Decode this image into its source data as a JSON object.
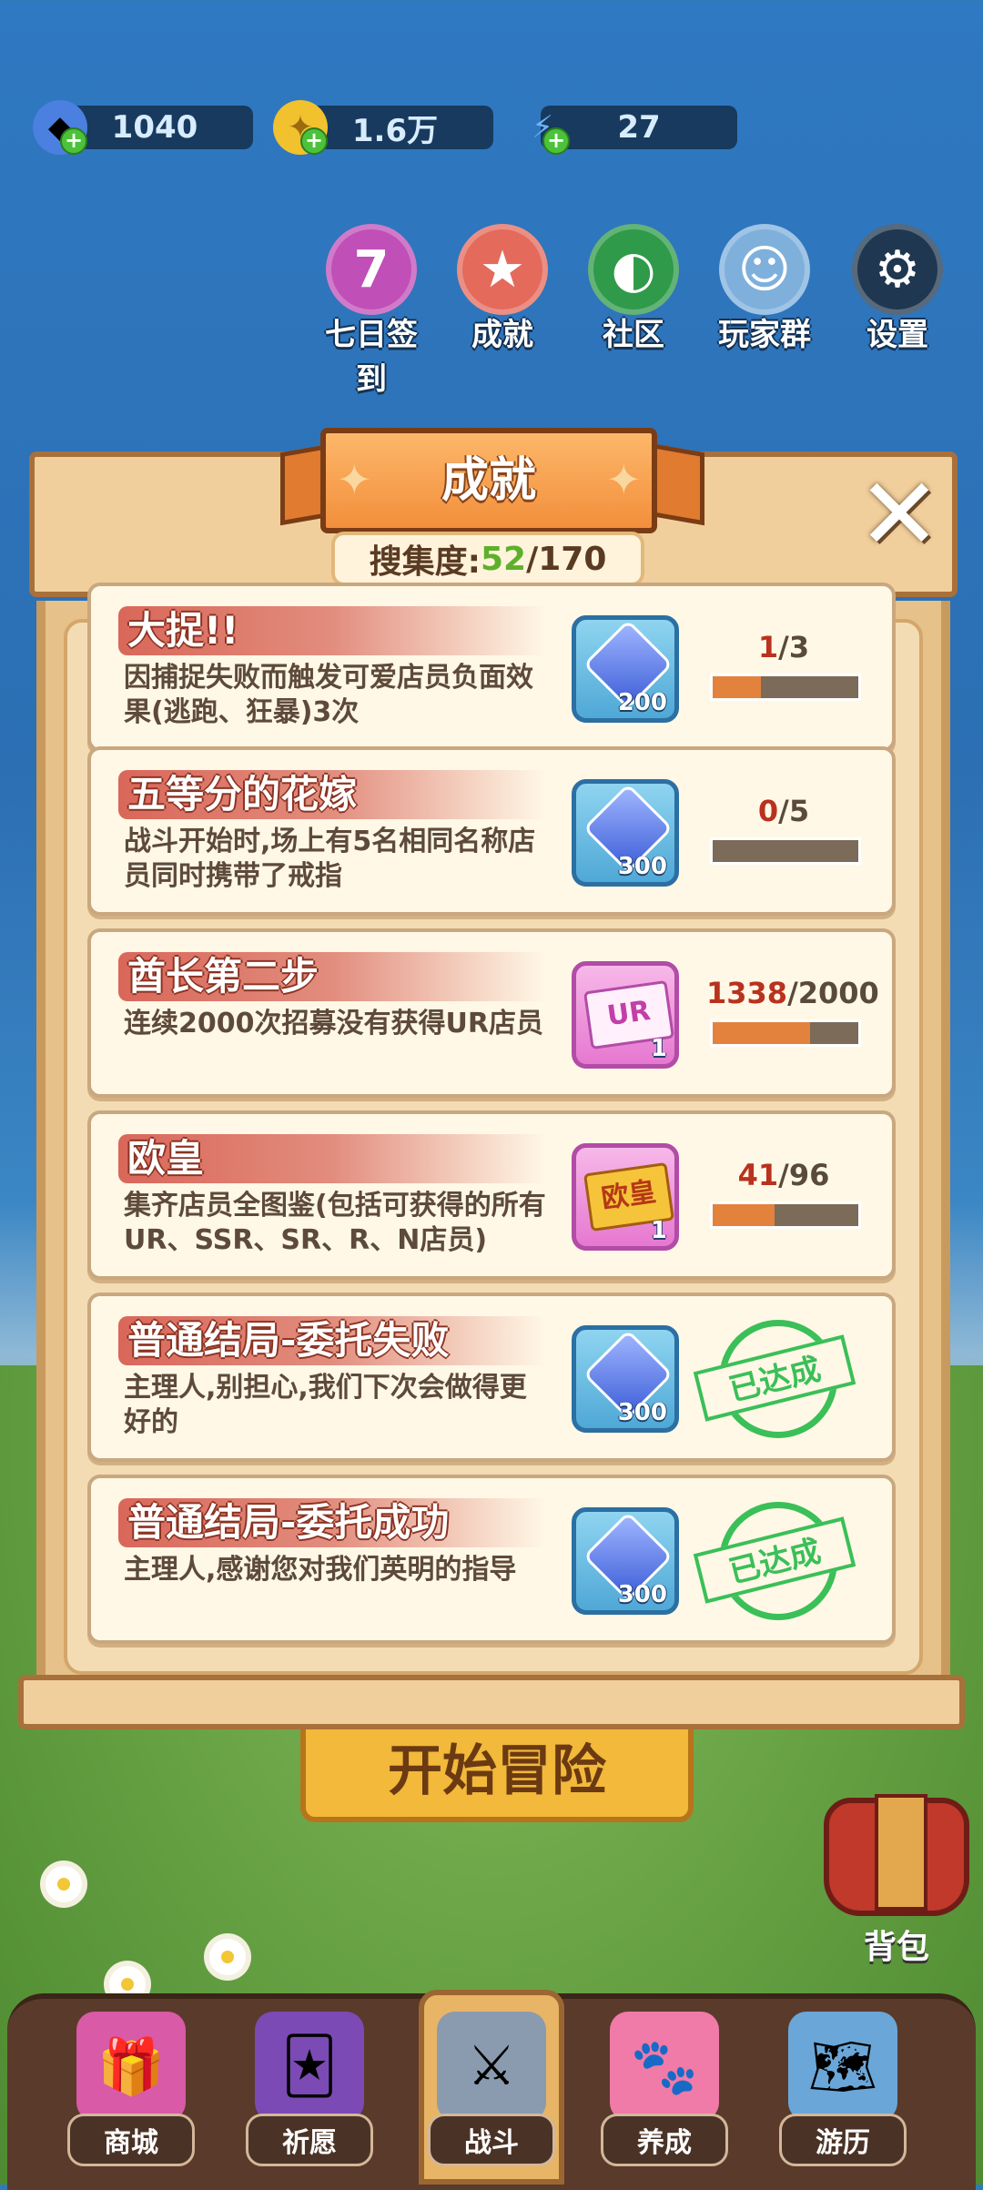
{
  "currency": [
    {
      "icon": "gem-icon",
      "value": "1040"
    },
    {
      "icon": "coin-icon",
      "value": "1.6万"
    },
    {
      "icon": "energy-icon",
      "value": "27"
    }
  ],
  "menu": [
    {
      "icon": "seven-day-icon",
      "glyph": "7",
      "label": "七日签到",
      "color": "#c14fb8"
    },
    {
      "icon": "trophy-icon",
      "glyph": "★",
      "label": "成就",
      "color": "#e46a5c"
    },
    {
      "icon": "community-icon",
      "glyph": "◐",
      "label": "社区",
      "color": "#2f9a4a"
    },
    {
      "icon": "penguin-icon",
      "glyph": "☺",
      "label": "玩家群",
      "color": "#7fb0dc"
    },
    {
      "icon": "gear-icon",
      "glyph": "⚙",
      "label": "设置",
      "color": "#1f3750"
    }
  ],
  "modal": {
    "title": "成就",
    "collect_label": "搜集度:",
    "collect_current": "52",
    "collect_total": "/170",
    "close_glyph": "✕"
  },
  "achievements": [
    {
      "title": "大捉!!",
      "desc": "因捕捉失败而触发可爱店员负面效果(逃跑、狂暴)3次",
      "reward_type": "gem",
      "reward_glyph": "",
      "reward_count": "200",
      "current": "1",
      "total": "/3",
      "progress": 0.33,
      "completed": false
    },
    {
      "title": "五等分的花嫁",
      "desc": "战斗开始时,场上有5名相同名称店员同时携带了戒指",
      "reward_type": "gem",
      "reward_glyph": "",
      "reward_count": "300",
      "current": "0",
      "total": "/5",
      "progress": 0,
      "completed": false
    },
    {
      "title": "酋长第二步",
      "desc": "连续2000次招募没有获得UR店员",
      "reward_type": "ticket",
      "reward_glyph": "UR",
      "reward_count": "1",
      "current": "1338",
      "total": "/2000",
      "progress": 0.669,
      "completed": false
    },
    {
      "title": "欧皇",
      "desc": "集齐店员全图鉴(包括可获得的所有UR、SSR、SR、R、N店员)",
      "reward_type": "gold",
      "reward_glyph": "欧皇",
      "reward_count": "1",
      "current": "41",
      "total": "/96",
      "progress": 0.427,
      "completed": false
    },
    {
      "title": "普通结局-委托失败",
      "desc": "主理人,别担心,我们下次会做得更好的",
      "reward_type": "gem",
      "reward_glyph": "",
      "reward_count": "300",
      "stamp": "已达成",
      "completed": true
    },
    {
      "title": "普通结局-委托成功",
      "desc": "主理人,感谢您对我们英明的指导",
      "reward_type": "gem",
      "reward_glyph": "",
      "reward_count": "300",
      "stamp": "已达成",
      "completed": true
    }
  ],
  "start_button": "开始冒险",
  "backpack_label": "背包",
  "nav": [
    {
      "icon": "shop-icon",
      "glyph": "🎁",
      "label": "商城"
    },
    {
      "icon": "wish-icon",
      "glyph": "🃏",
      "label": "祈愿"
    },
    {
      "icon": "battle-icon",
      "glyph": "⚔",
      "label": "战斗",
      "active": true
    },
    {
      "icon": "paw-icon",
      "glyph": "🐾",
      "label": "养成"
    },
    {
      "icon": "map-icon",
      "glyph": "🗺",
      "label": "游历"
    }
  ]
}
